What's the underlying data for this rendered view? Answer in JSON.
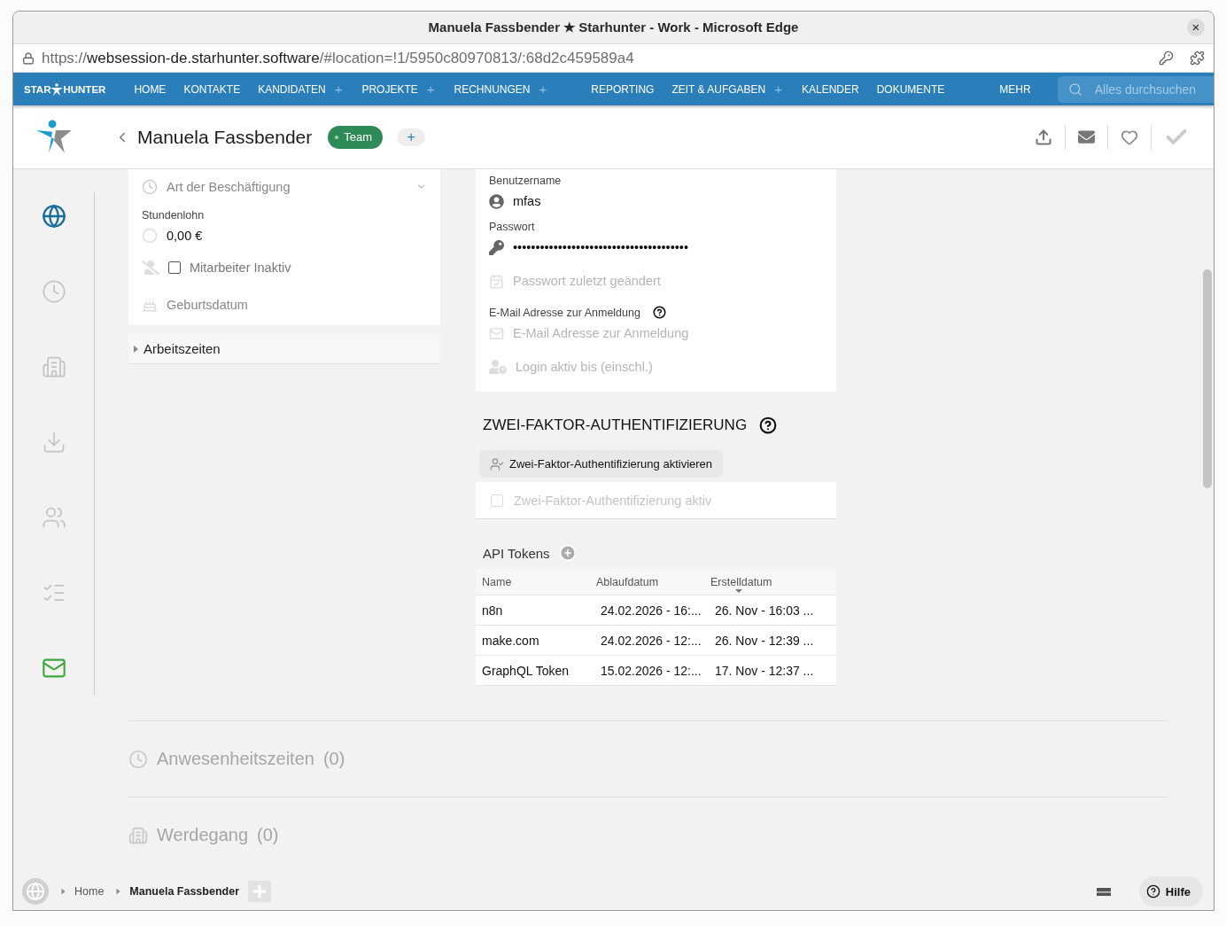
{
  "window": {
    "title": "Manuela Fassbender ★ Starhunter - Work - Microsoft Edge",
    "close": "×"
  },
  "address_bar": {
    "scheme": "https://",
    "host": "websession-de.starhunter.software",
    "path": "/#location=!1/5950c80970813/:68d2c459589a4"
  },
  "navbar": {
    "logo_left": "STAR",
    "logo_right": "HUNTER",
    "groups": [
      [
        {
          "label": "HOME"
        },
        {
          "label": "KONTAKTE"
        },
        {
          "label": "KANDIDATEN",
          "add": "+"
        },
        {
          "label": "PROJEKTE",
          "add": "+"
        },
        {
          "label": "RECHNUNGEN",
          "add": "+"
        }
      ],
      [
        {
          "label": "REPORTING"
        },
        {
          "label": "ZEIT & AUFGABEN",
          "add": "+"
        },
        {
          "label": "KALENDER"
        },
        {
          "label": "DOKUMENTE"
        }
      ],
      [
        {
          "label": "MEHR"
        }
      ]
    ],
    "search": {
      "placeholder": "Alles durchsuchen"
    }
  },
  "header": {
    "name": "Manuela Fassbender",
    "tag": {
      "label": "Team",
      "color": "#2e8b57"
    },
    "add": "+"
  },
  "sidebar": {
    "items": [
      {
        "selected": true,
        "highlighted": false
      },
      {
        "selected": false,
        "highlighted": false
      },
      {
        "selected": false,
        "highlighted": false
      },
      {
        "selected": false,
        "highlighted": false
      },
      {
        "selected": false,
        "highlighted": false
      },
      {
        "selected": false,
        "highlighted": false
      },
      {
        "selected": false,
        "highlighted": true
      }
    ]
  },
  "employment_fields": [
    {
      "kind": "select",
      "placeholder": "Art der Beschäftigung"
    },
    {
      "kind": "value",
      "label": "Stundenlohn",
      "value": "0,00 €"
    },
    {
      "kind": "checkbox",
      "label": "Mitarbeiter Inaktiv",
      "checked": false
    },
    {
      "kind": "input",
      "placeholder": "Geburtsdatum"
    }
  ],
  "working_hours": {
    "label": "Arbeitszeiten",
    "expanded": false
  },
  "login_fields": [
    {
      "kind": "value",
      "label": "Benutzername",
      "value": "mfas"
    },
    {
      "kind": "value",
      "label": "Passwort",
      "value": "•••••••••••••••••••••••••••••••••••••••"
    },
    {
      "kind": "input",
      "placeholder": "Passwort zuletzt geändert"
    },
    {
      "kind": "input",
      "label": "E-Mail Adresse zur Anmeldung",
      "help": true,
      "placeholder": "E-Mail Adresse zur Anmeldung"
    },
    {
      "kind": "input",
      "placeholder": "Login aktiv bis (einschl.)"
    }
  ],
  "two_factor": {
    "title": "ZWEI-FAKTOR-AUTHENTIFIZIERUNG",
    "button": "Zwei-Faktor-Authentifizierung aktivieren",
    "checkbox": {
      "label": "Zwei-Faktor-Authentifizierung aktiv",
      "checked": false
    }
  },
  "api_tokens": {
    "title": "API Tokens",
    "columns": [
      {
        "label": "Name",
        "sorted": false
      },
      {
        "label": "Ablaufdatum",
        "sorted": false
      },
      {
        "label": "Erstelldatum",
        "sorted": true
      }
    ],
    "rows": [
      [
        "n8n",
        "24.02.2026 - 16:...",
        "26. Nov - 16:03 ..."
      ],
      [
        "make.com",
        "24.02.2026 - 12:...",
        "26. Nov - 12:39 ..."
      ],
      [
        "GraphQL Token",
        "15.02.2026 - 12:...",
        "17. Nov - 12:37 ..."
      ]
    ]
  },
  "sections": [
    {
      "title": "Anwesenheitszeiten",
      "count": "(0)"
    },
    {
      "title": "Werdegang",
      "count": "(0)"
    }
  ],
  "breadcrumbs": [
    "Home",
    "Manuela Fassbender"
  ],
  "help_button": "Hilfe"
}
